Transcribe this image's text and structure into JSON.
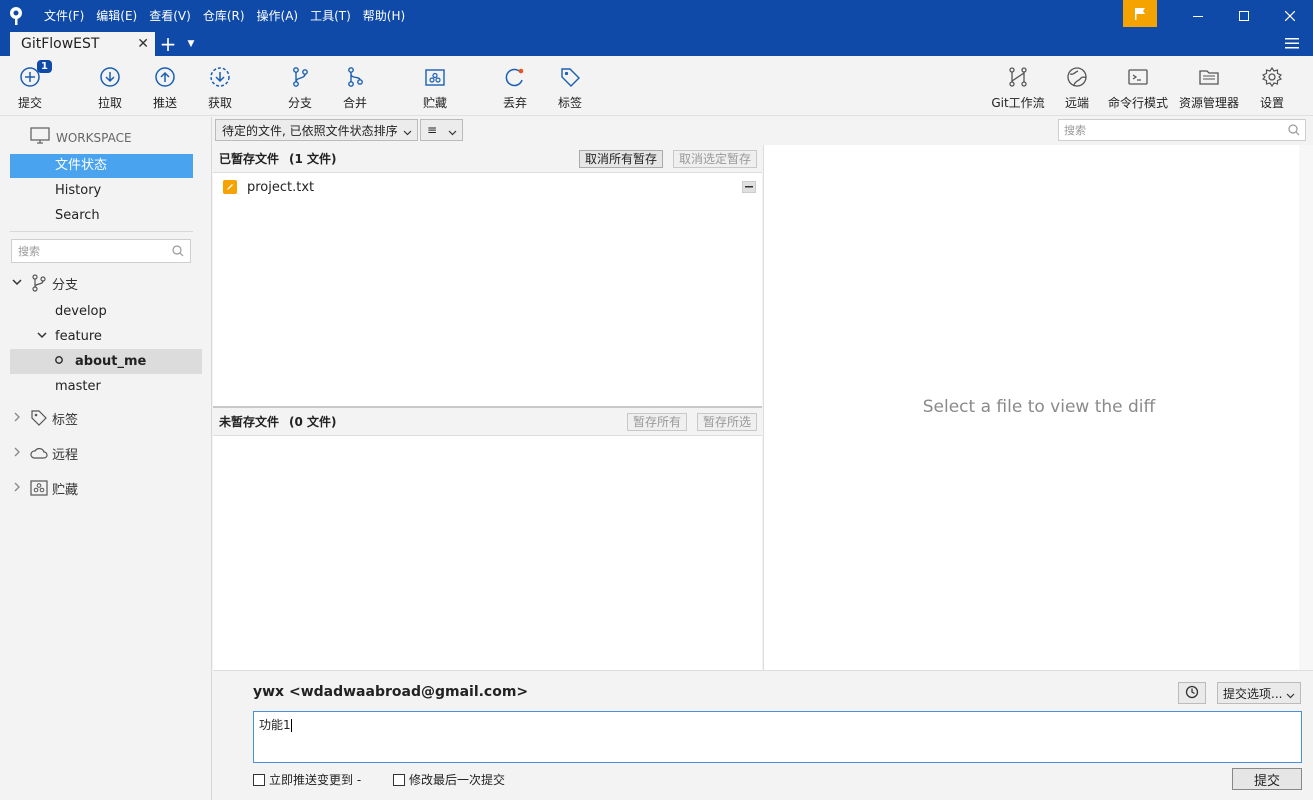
{
  "menu": [
    "文件(F)",
    "编辑(E)",
    "查看(V)",
    "仓库(R)",
    "操作(A)",
    "工具(T)",
    "帮助(H)"
  ],
  "tab": {
    "title": "GitFlowEST",
    "close": "✕",
    "add": "+",
    "dropdown": "▼"
  },
  "toolbar": {
    "left": [
      {
        "label": "提交",
        "icon": "commit-icon",
        "badge": "1"
      },
      {
        "label": "拉取",
        "icon": "pull-icon"
      },
      {
        "label": "推送",
        "icon": "push-icon"
      },
      {
        "label": "获取",
        "icon": "fetch-icon"
      },
      {
        "label": "分支",
        "icon": "branch-icon"
      },
      {
        "label": "合并",
        "icon": "merge-icon"
      },
      {
        "label": "贮藏",
        "icon": "stash-icon"
      },
      {
        "label": "丢弃",
        "icon": "discard-icon"
      },
      {
        "label": "标签",
        "icon": "tag-icon"
      }
    ],
    "right": [
      {
        "label": "Git工作流",
        "icon": "gitflow-icon"
      },
      {
        "label": "远端",
        "icon": "globe-icon"
      },
      {
        "label": "命令行模式",
        "icon": "terminal-icon"
      },
      {
        "label": "资源管理器",
        "icon": "folder-icon"
      },
      {
        "label": "设置",
        "icon": "gear-icon"
      }
    ]
  },
  "sidebar": {
    "workspace": "WORKSPACE",
    "items": [
      "文件状态",
      "History",
      "Search"
    ],
    "search_placeholder": "搜索",
    "branches_label": "分支",
    "branches": [
      "develop",
      "feature",
      "about_me",
      "master"
    ],
    "tags_label": "标签",
    "remotes_label": "远程",
    "stashes_label": "贮藏"
  },
  "filter": {
    "sort": "待定的文件, 已依照文件状态排序",
    "view": "≡",
    "search_placeholder": "搜索"
  },
  "staged": {
    "title": "已暂存文件",
    "count": "(1 文件)",
    "unstage_all": "取消所有暂存",
    "unstage_selected": "取消选定暂存",
    "files": [
      "project.txt"
    ]
  },
  "unstaged": {
    "title": "未暂存文件",
    "count": "(0 文件)",
    "stage_all": "暂存所有",
    "stage_selected": "暂存所选"
  },
  "diff": {
    "placeholder": "Select a file to view the diff"
  },
  "commit": {
    "author": "ywx <wdadwaabroad@gmail.com>",
    "options": "提交选项...",
    "message": "功能1",
    "push_checkbox": "立即推送变更到 -",
    "amend_checkbox": "修改最后一次提交",
    "commit_button": "提交"
  },
  "colors": {
    "titlebar": "#0f4aa8",
    "selection": "#4aa3ee",
    "accent_flag": "#f5a300"
  }
}
